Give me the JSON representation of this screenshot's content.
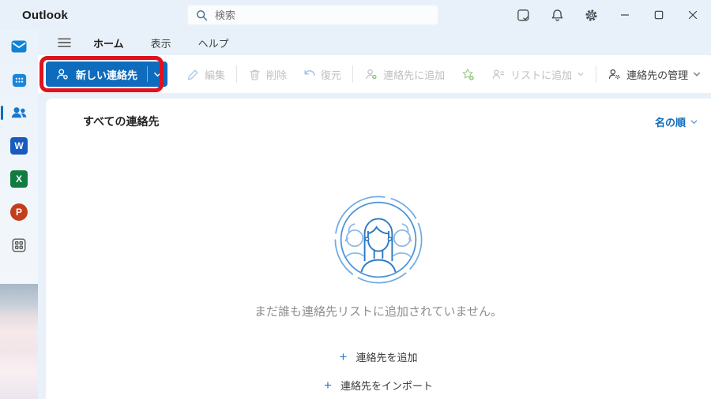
{
  "window": {
    "title": "Outlook"
  },
  "titlebar": {
    "search_placeholder": "検索",
    "icons": [
      "my-day",
      "notifications",
      "settings",
      "minimize",
      "maximize",
      "close"
    ]
  },
  "sidebar": {
    "items": [
      {
        "name": "mail",
        "selected": false
      },
      {
        "name": "calendar",
        "selected": false
      },
      {
        "name": "people",
        "selected": true
      },
      {
        "name": "word",
        "selected": false,
        "letter": "W"
      },
      {
        "name": "excel",
        "selected": false,
        "letter": "X"
      },
      {
        "name": "powerpoint",
        "selected": false,
        "letter": "P"
      },
      {
        "name": "apps",
        "selected": false
      }
    ]
  },
  "menubar": {
    "tabs": [
      {
        "label": "ホーム",
        "selected": true
      },
      {
        "label": "表示",
        "selected": false
      },
      {
        "label": "ヘルプ",
        "selected": false
      }
    ]
  },
  "toolbar": {
    "new_contact_label": "新しい連絡先",
    "items": [
      {
        "label": "編集",
        "enabled": false
      },
      {
        "label": "削除",
        "enabled": false
      },
      {
        "label": "復元",
        "enabled": false
      },
      {
        "label": "連絡先に追加",
        "enabled": false
      },
      {
        "label": "リストに追加",
        "enabled": false,
        "has_dropdown": true
      },
      {
        "label": "連絡先の管理",
        "enabled": true,
        "has_dropdown": true
      }
    ]
  },
  "content": {
    "list_title": "すべての連絡先",
    "sort_label": "名の順",
    "empty_message": "まだ誰も連絡先リストに追加されていません。",
    "action_add": "連絡先を追加",
    "action_import": "連絡先をインポート"
  },
  "annotation": {
    "shape": "rounded-rect",
    "color": "#e0121f",
    "target": "new-contact-button"
  },
  "icons": {
    "plus": "+"
  },
  "colors": {
    "accent": "#0f6cbd",
    "titlebar_bg": "#e8f1f9",
    "highlight_red": "#e0121f"
  }
}
